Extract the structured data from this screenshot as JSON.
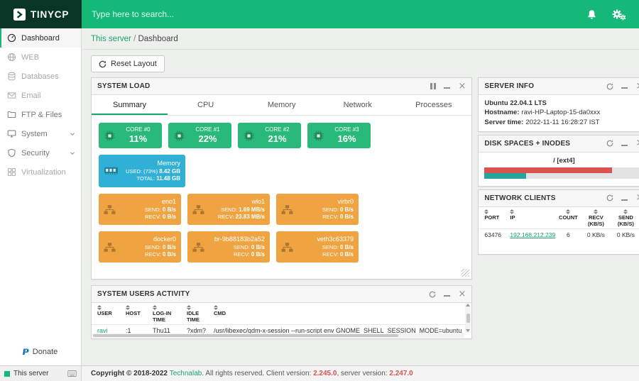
{
  "topbar": {
    "logo": "TINYCP",
    "search_placeholder": "Type here to search..."
  },
  "sidebar": {
    "items": [
      {
        "label": "Dashboard"
      },
      {
        "label": "WEB"
      },
      {
        "label": "Databases"
      },
      {
        "label": "Email"
      },
      {
        "label": "FTP & Files"
      },
      {
        "label": "System"
      },
      {
        "label": "Security"
      },
      {
        "label": "Virtualization"
      }
    ],
    "donate_label": "Donate",
    "footer_label": "This server"
  },
  "breadcrumb": {
    "root": "This server",
    "separator": " / ",
    "current": "Dashboard"
  },
  "toolbar": {
    "reset_layout": "Reset Layout"
  },
  "system_load": {
    "title": "SYSTEM LOAD",
    "tabs": [
      "Summary",
      "CPU",
      "Memory",
      "Network",
      "Processes"
    ],
    "active_tab": "Summary",
    "cores": [
      {
        "name": "CORE #0",
        "value": "11%"
      },
      {
        "name": "CORE #1",
        "value": "22%"
      },
      {
        "name": "CORE #2",
        "value": "21%"
      },
      {
        "name": "CORE #3",
        "value": "16%"
      }
    ],
    "memory": {
      "name": "Memory",
      "used_prefix": "USED: (73%)",
      "used_value": "8.42 GB",
      "total_label": "TOTAL:",
      "total_value": "11.48 GB"
    },
    "labels": {
      "send": "SEND:",
      "recv": "RECV:"
    },
    "interfaces": [
      {
        "name": "eno1",
        "send": "0 B/s",
        "recv": "0 B/s"
      },
      {
        "name": "wlo1",
        "send": "1.69 MB/s",
        "recv": "23.83 MB/s"
      },
      {
        "name": "virbr0",
        "send": "0 B/s",
        "recv": "0 B/s"
      },
      {
        "name": "docker0",
        "send": "0 B/s",
        "recv": "0 B/s"
      },
      {
        "name": "br-9b88183b2a52",
        "send": "0 B/s",
        "recv": "0 B/s"
      },
      {
        "name": "veth3c63379",
        "send": "0 B/s",
        "recv": "0 B/s"
      }
    ]
  },
  "users_activity": {
    "title": "SYSTEM USERS ACTIVITY",
    "columns": [
      "USER",
      "HOST",
      "LOG-IN TIME",
      "IDLE TIME",
      "CMD"
    ],
    "rows": [
      [
        "ravi",
        ":1",
        "Thu11",
        "?xdm?",
        "/usr/libexec/gdm-x-session --run-script env GNOME_SHELL_SESSION_MODE=ubuntu"
      ]
    ]
  },
  "server_info": {
    "title": "SERVER INFO",
    "os": "Ubuntu 22.04.1 LTS",
    "hostname_label": "Hostname:",
    "hostname": "ravi-HP-Laptop-15-da0xxx",
    "time_label": "Server time:",
    "time": "2022-11-11 16:28:27 IST"
  },
  "disk_spaces": {
    "title": "DISK SPACES + INODES",
    "mount": "/ [ext4]",
    "space_used_pct": 80,
    "inodes_used_pct": 26
  },
  "network_clients": {
    "title": "NETWORK CLIENTS",
    "columns": [
      "PORT",
      "IP",
      "COUNT",
      "RECV (KB/S)",
      "SEND (KB/S)"
    ],
    "rows": [
      [
        "63476",
        "192.168.212.239",
        "6",
        "0 KB/s",
        "0 KB/s"
      ]
    ]
  },
  "footer": {
    "copyright_bold": "Copyright © 2018-2022 ",
    "brand": "Technalab",
    "text_mid": ". All rights reserved. Client version: ",
    "client_version": "2.245.0",
    "text_mid2": ", server version: ",
    "server_version": "2.247.0"
  },
  "colors": {
    "topbar_green": "#15b877",
    "logo_bg": "#093527",
    "core_widget_green": "#29b97a",
    "memory_widget_blue": "#31b0d5",
    "network_widget_orange": "#f0a441",
    "link_green": "#1aa36c",
    "disk_space_red": "#d9534f",
    "disk_inodes_teal": "#26a69a",
    "version_red": "#d9534f"
  }
}
